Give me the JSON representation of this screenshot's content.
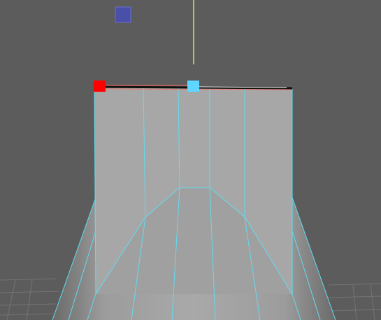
{
  "viewport": {
    "background": "#5c5c5c",
    "grid_color": "#737373",
    "mesh_fill": "#a9a9a9",
    "wire_color": "#62dcef",
    "axis_color": "#e5e04a"
  },
  "manipulator": {
    "handle_left_color": "#ff0000",
    "handle_mid_color": "#5fd6ff",
    "selected_edge_color": "#ff6a5a",
    "view_cube_color": "#4a4fa8"
  },
  "icons": {
    "view_cube": "view-cube-icon",
    "scale_handle": "square-handle-icon"
  }
}
